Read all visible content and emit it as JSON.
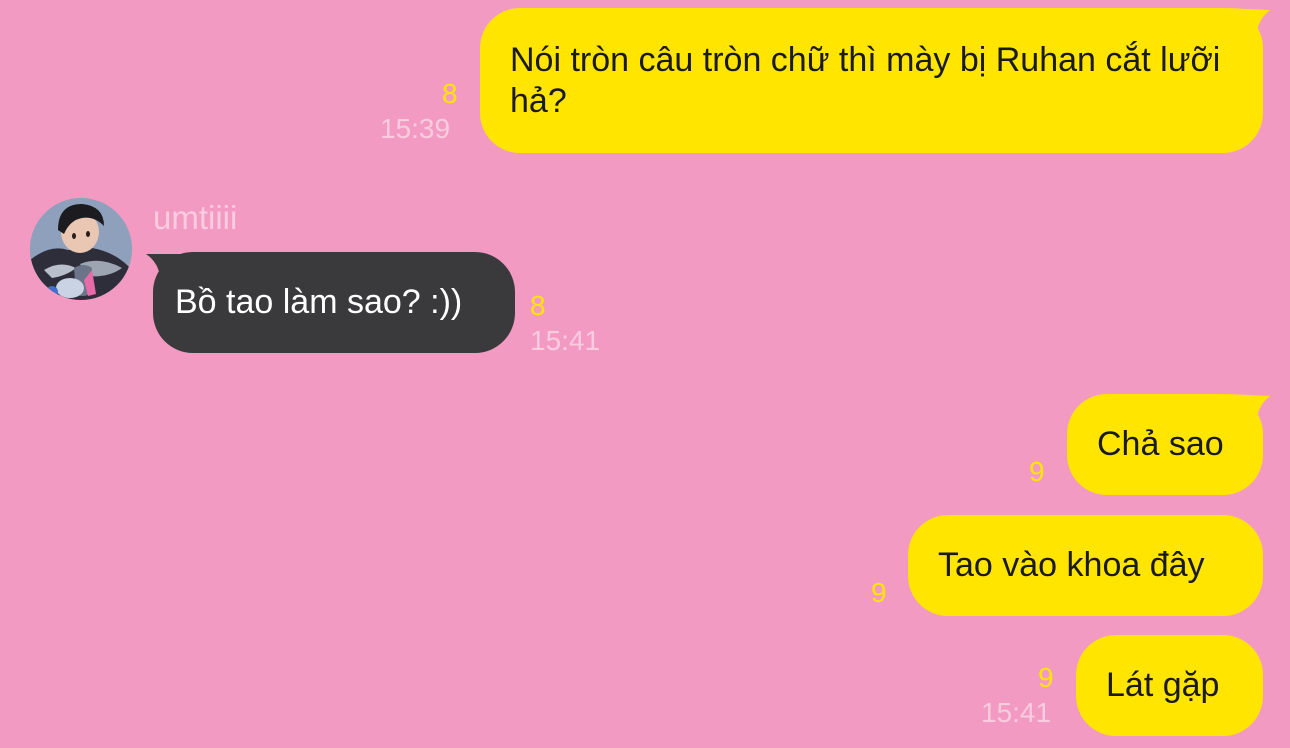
{
  "chat": {
    "messages": [
      {
        "direction": "outgoing",
        "text": "Nói tròn câu tròn chữ thì mày bị Ruhan cắt lưỡi hả?",
        "read_count": "8",
        "time": "15:39"
      },
      {
        "direction": "incoming",
        "sender": "umtiiii",
        "avatar_icon": "user-avatar",
        "text": "Bồ tao làm sao? :))",
        "read_count": "8",
        "time": "15:41"
      },
      {
        "direction": "outgoing",
        "text": "Chả sao",
        "read_count": "9"
      },
      {
        "direction": "outgoing",
        "text": "Tao vào khoa đây",
        "read_count": "9"
      },
      {
        "direction": "outgoing",
        "text": "Lát gặp",
        "read_count": "9",
        "time": "15:41"
      }
    ]
  },
  "colors": {
    "background": "#F39AC3",
    "outgoing_bubble": "#FFE500",
    "incoming_bubble": "#3A3A3C",
    "read_count": "#FFE500",
    "timestamp": "#F9CCE0"
  }
}
